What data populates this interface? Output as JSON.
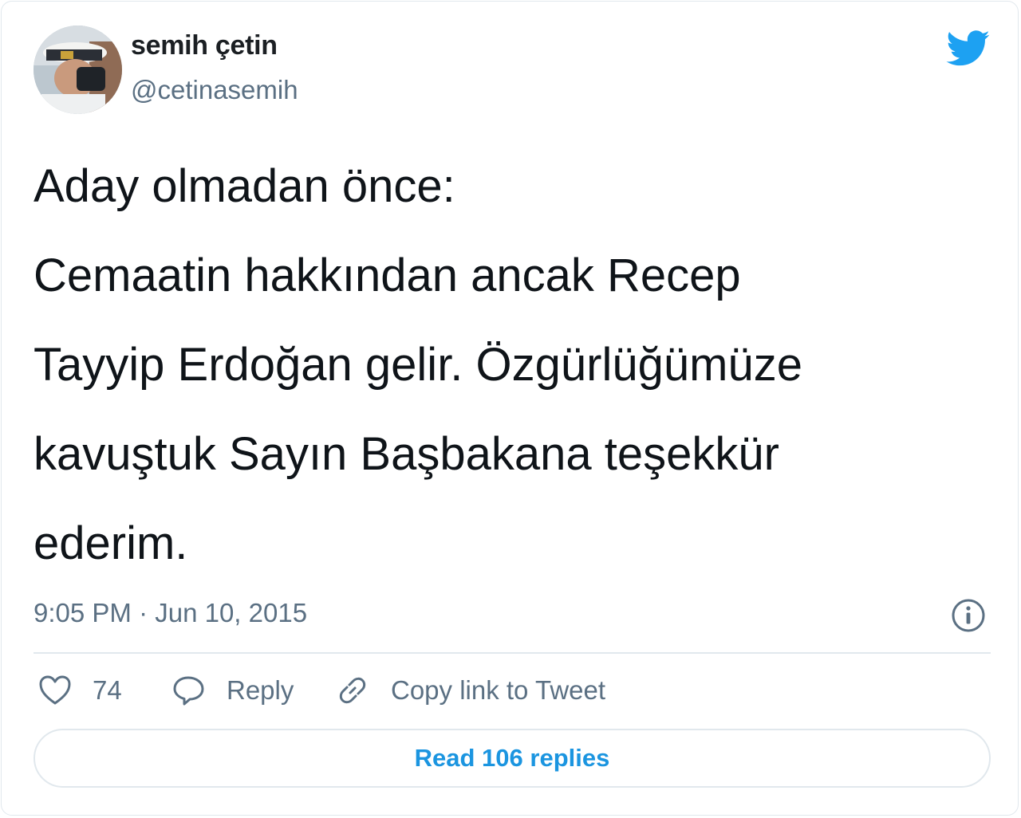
{
  "author": {
    "display_name": "semih çetin",
    "handle": "@cetinasemih"
  },
  "tweet": {
    "lines": [
      "Aday olmadan önce:",
      "Cemaatin hakkından ancak Recep",
      "Tayyip Erdoğan gelir. Özgürlüğümüze",
      "kavuştuk Sayın Başbakana teşekkür",
      "ederim."
    ],
    "timestamp": "9:05 PM · Jun 10, 2015"
  },
  "actions": {
    "likes": "74",
    "reply_label": "Reply",
    "copy_link_label": "Copy link to Tweet"
  },
  "read_replies_label": "Read 106 replies",
  "icons": {
    "brand": "twitter-bird-icon",
    "info": "info-icon",
    "like": "heart-icon",
    "reply": "speech-bubble-icon",
    "copy": "link-icon"
  },
  "colors": {
    "brand_blue": "#1da1f2",
    "link_blue": "#1b95e0",
    "secondary_text": "#5b7083",
    "primary_text": "#0f1419",
    "border": "#e1e8ed"
  }
}
